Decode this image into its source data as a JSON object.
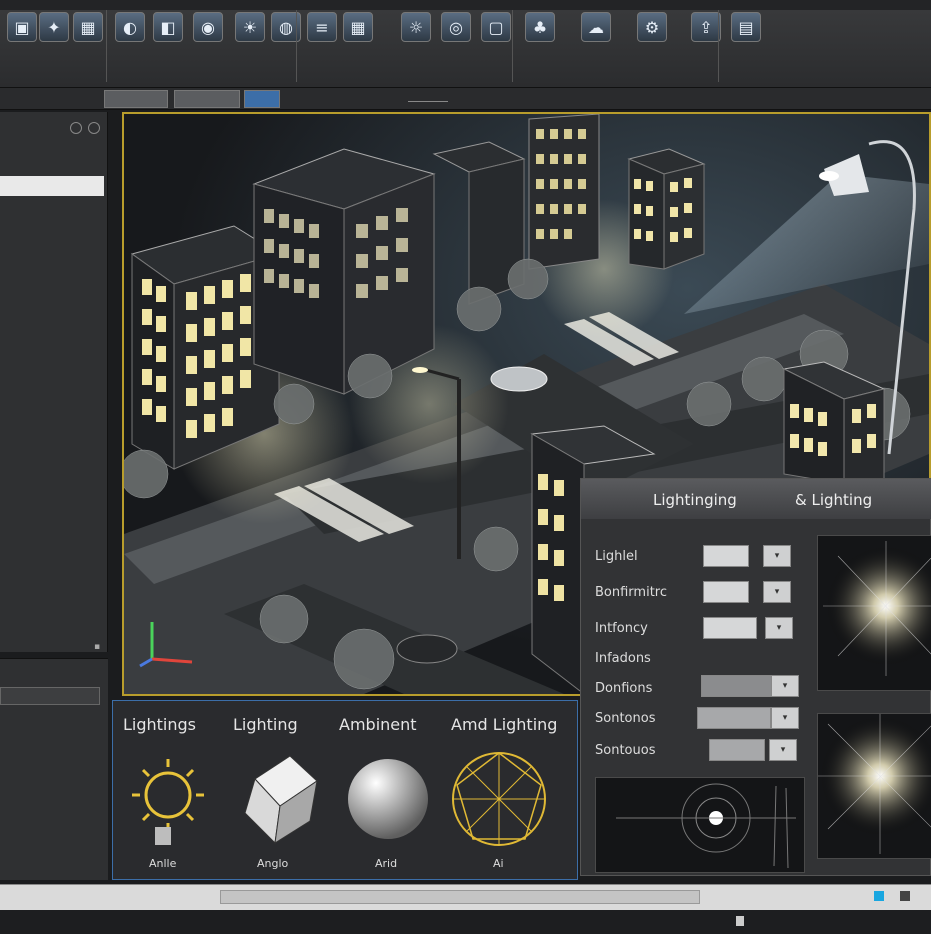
{
  "ribbon": {
    "buttons": [
      {
        "label": "",
        "icon": "cube-icon"
      },
      {
        "label": "",
        "icon": "light-icon"
      },
      {
        "label": "",
        "icon": "scene-icon"
      },
      {
        "label": "",
        "icon": "material-icon"
      },
      {
        "label": "",
        "icon": "render-icon"
      },
      {
        "label": "",
        "icon": "camera-icon"
      },
      {
        "label": "",
        "icon": "sun-icon"
      },
      {
        "label": "",
        "icon": "globe-icon"
      },
      {
        "label": "",
        "icon": "layers-icon"
      },
      {
        "label": "",
        "icon": "grid-icon"
      },
      {
        "label": "",
        "icon": "lamp-icon"
      },
      {
        "label": "",
        "icon": "eye-icon"
      },
      {
        "label": "",
        "icon": "box-icon"
      },
      {
        "label": "",
        "icon": "tree-icon"
      },
      {
        "label": "",
        "icon": "sky-icon"
      },
      {
        "label": "",
        "icon": "settings-icon"
      },
      {
        "label": "",
        "icon": "export-icon"
      },
      {
        "label": "",
        "icon": "view-icon"
      }
    ]
  },
  "subbar": {
    "items": [
      "",
      "",
      "",
      "",
      ""
    ]
  },
  "left_panel": {
    "items": [
      "",
      "",
      "",
      "",
      "",
      "",
      "",
      "",
      "",
      "",
      "",
      ""
    ],
    "selected": ""
  },
  "left_panel2": {
    "header": "",
    "input": "",
    "rows": [
      "",
      "",
      "",
      "",
      "",
      "",
      ""
    ]
  },
  "viewport": {
    "label": ""
  },
  "bottom_panel": {
    "titles": [
      "Lightings",
      "Lighting",
      "Ambinent",
      "Amd Lighting"
    ],
    "captions": [
      "Anlle",
      "Anglo",
      "Arid",
      "Ai"
    ]
  },
  "properties": {
    "header": [
      "Lightinging",
      "& Lighting"
    ],
    "rows": [
      "Lighlel",
      "Bonfirmitrc",
      "Intfoncy",
      "Infadons",
      "Donfions",
      "Sontonos",
      "Sontouos"
    ]
  },
  "statusbar": {
    "text": ""
  },
  "taskbar": {
    "items": [
      "",
      "",
      "",
      "",
      "",
      "",
      "",
      ""
    ],
    "right": ""
  },
  "colors": {
    "accent": "#b89d2c",
    "panel_border": "#3c6ea8",
    "window": "#2f3032"
  }
}
